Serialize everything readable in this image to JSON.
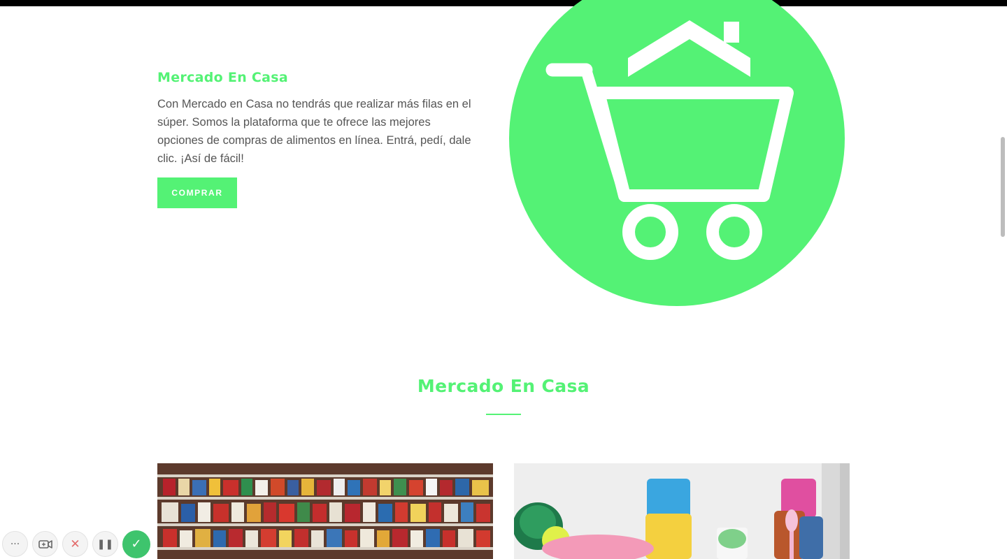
{
  "hero": {
    "title": "Mercado En Casa",
    "description": "Con Mercado en Casa no tendrás que realizar más filas en el súper. Somos la plataforma que te ofrece las mejores opciones de compras de alimentos en línea. Entrá, pedí, dale clic. ¡Así de fácil!",
    "button_label": "COMPRAR"
  },
  "logo": {
    "icon": "shopping-cart-house-icon",
    "color": "#54f275"
  },
  "section": {
    "title": "Mercado En Casa"
  },
  "products": [
    {
      "name": "grocery-shelf-image"
    },
    {
      "name": "household-products-image"
    }
  ],
  "recorder_controls": [
    {
      "name": "more-options-button",
      "icon": "ellipsis-icon",
      "glyph": "···"
    },
    {
      "name": "camera-button",
      "icon": "camera-icon",
      "glyph": ""
    },
    {
      "name": "cancel-recording-button",
      "icon": "close-icon",
      "glyph": "✕"
    },
    {
      "name": "pause-recording-button",
      "icon": "pause-icon",
      "glyph": "❚❚"
    },
    {
      "name": "finish-recording-button",
      "icon": "check-icon",
      "glyph": "✓"
    }
  ],
  "colors": {
    "accent": "#54f275",
    "text": "#555555",
    "record_done": "#3ec46d"
  }
}
